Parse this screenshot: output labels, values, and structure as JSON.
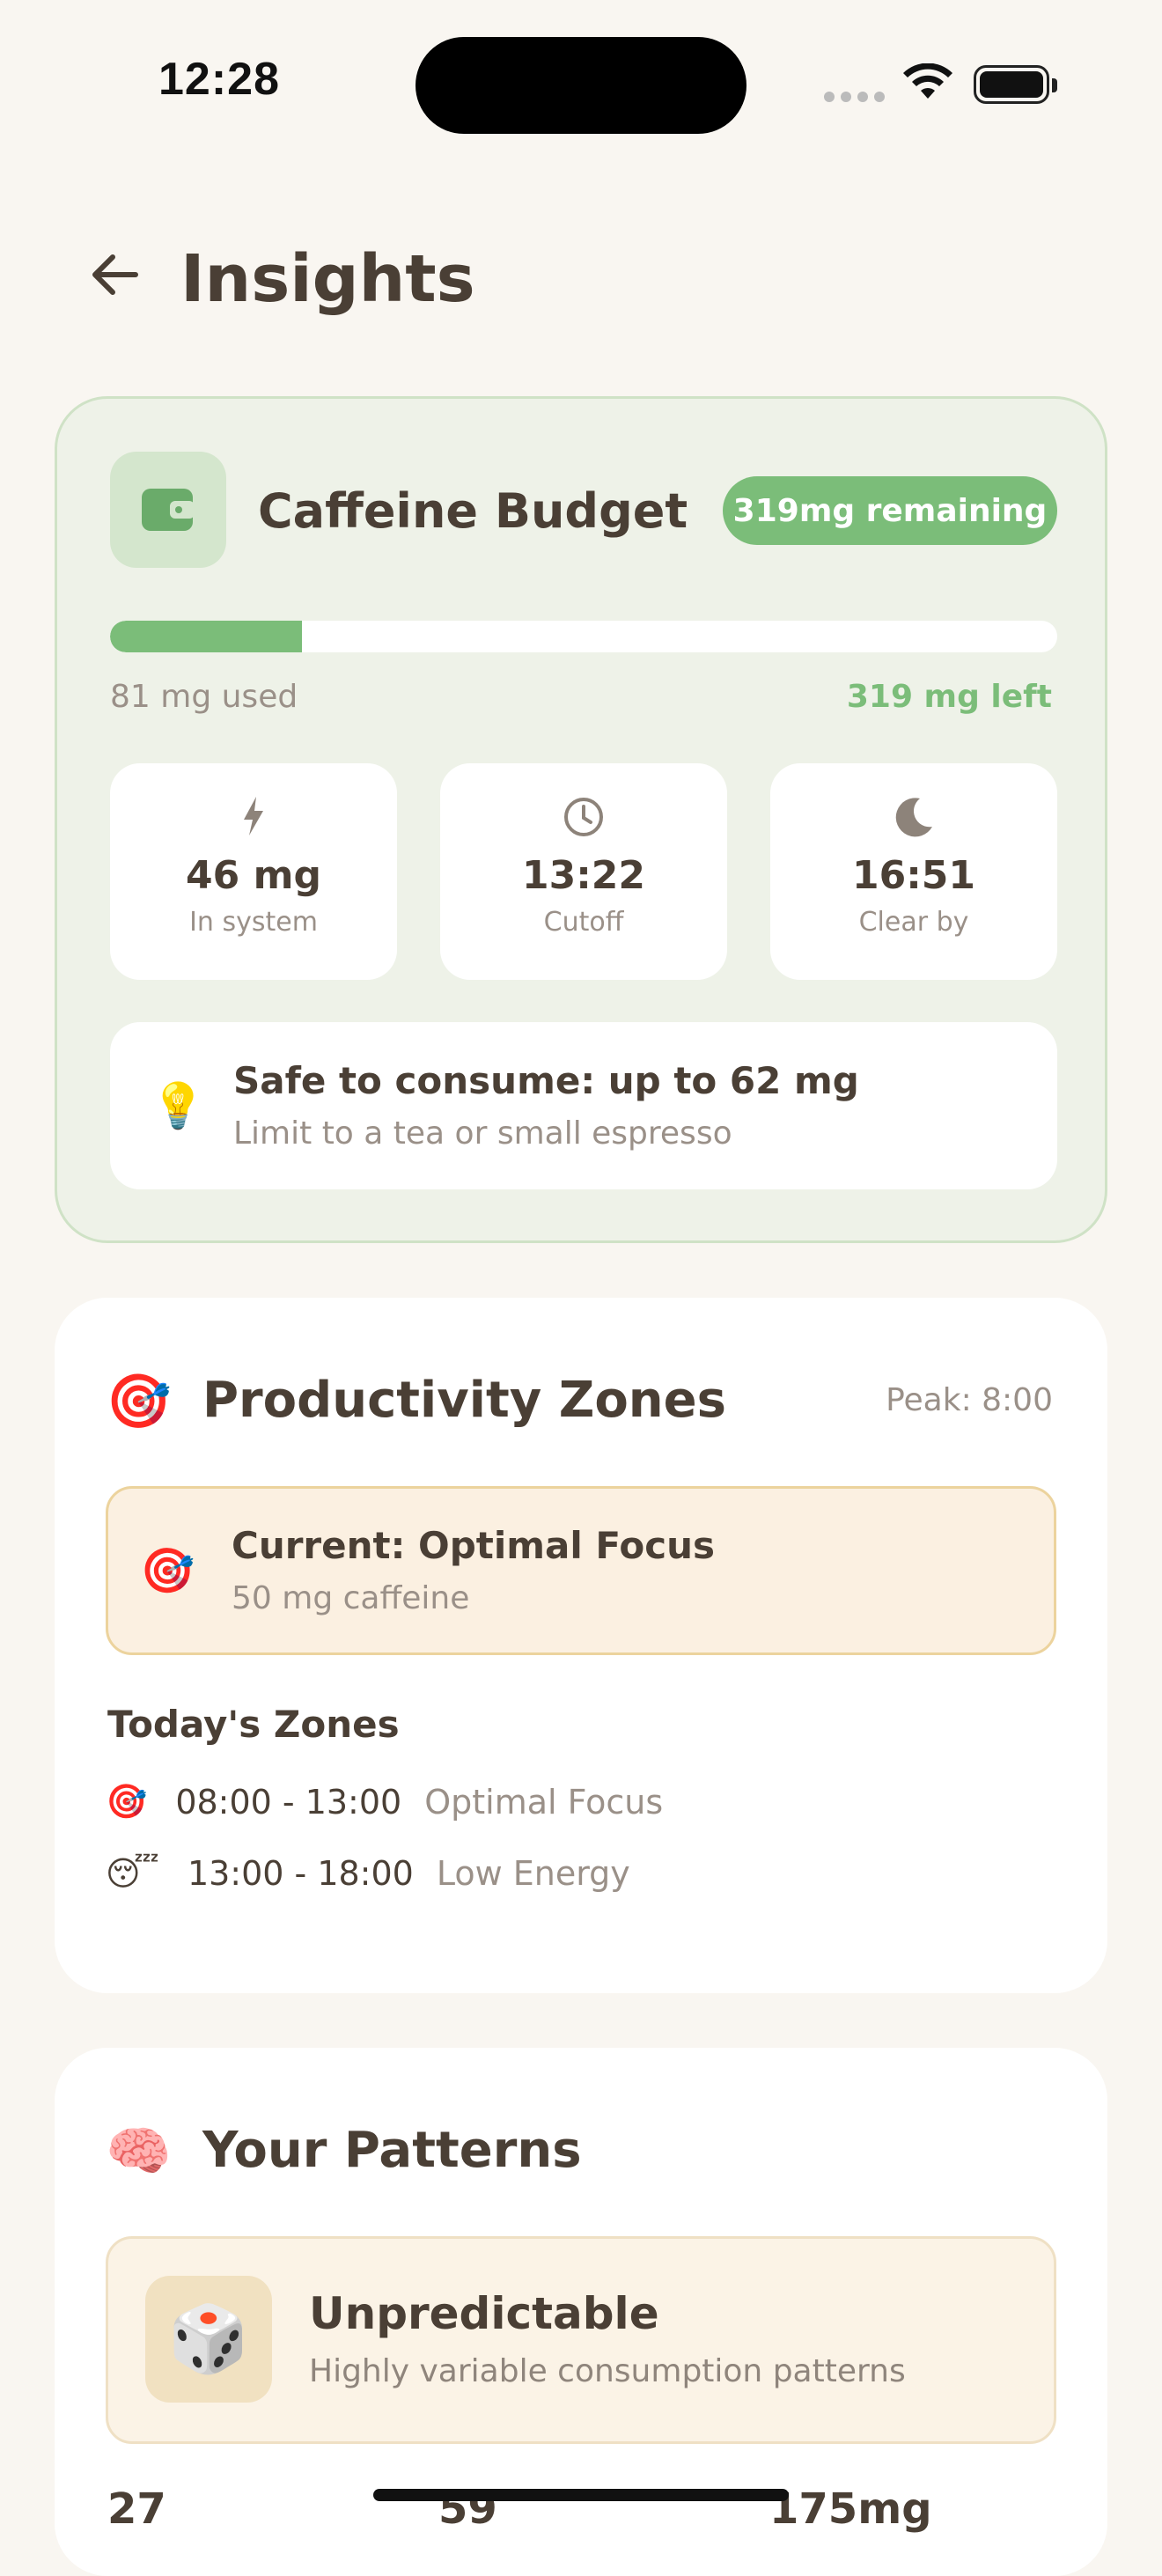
{
  "status": {
    "time": "12:28"
  },
  "header": {
    "title": "Insights"
  },
  "budget": {
    "title": "Caffeine Budget",
    "remaining_badge": "319mg remaining",
    "used_fraction": 0.2025,
    "used_label": "81 mg used",
    "left_label": "319 mg left",
    "stats": [
      {
        "icon": "bolt-icon",
        "value": "46 mg",
        "label": "In system"
      },
      {
        "icon": "clock-icon",
        "value": "13:22",
        "label": "Cutoff"
      },
      {
        "icon": "moon-icon",
        "value": "16:51",
        "label": "Clear by"
      }
    ],
    "safe": {
      "title": "Safe to consume: up to 62 mg",
      "subtitle": "Limit to a tea or small espresso"
    },
    "accent": "#7bbd79"
  },
  "productivity": {
    "title": "Productivity Zones",
    "peak": "Peak: 8:00",
    "current_title": "Current: Optimal Focus",
    "current_sub": "50 mg caffeine",
    "zones_heading": "Today's Zones",
    "zones": [
      {
        "icon": "target-icon",
        "time": "08:00 - 13:00",
        "name": "Optimal Focus"
      },
      {
        "icon": "sleepy-face-icon",
        "time": "13:00 - 18:00",
        "name": "Low Energy"
      }
    ]
  },
  "patterns": {
    "title": "Your Patterns",
    "type_title": "Unpredictable",
    "type_sub": "Highly variable consumption patterns",
    "stats": [
      "27",
      "59",
      "175mg"
    ]
  }
}
